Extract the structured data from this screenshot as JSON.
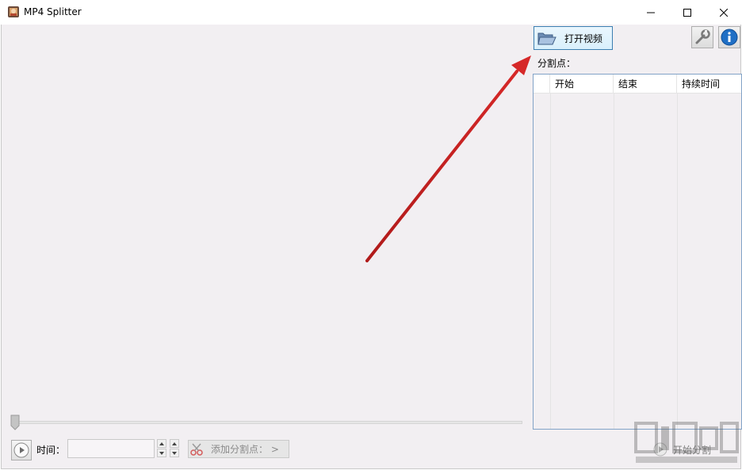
{
  "window": {
    "title": "MP4 Splitter"
  },
  "toolbar": {
    "open_video_label": "打开视频"
  },
  "split_points": {
    "label": "分割点：",
    "columns": [
      "开始",
      "结束",
      "持续时间"
    ],
    "rows": []
  },
  "playback": {
    "time_label": "时间：",
    "time_value": "",
    "progress": 0
  },
  "actions": {
    "add_split_label": "添加分割点： >",
    "start_split_label": "开始分割"
  },
  "colors": {
    "client_bg": "#f2eff2",
    "accent_border": "#3c7fb1",
    "annotation_arrow": "#c81e1e",
    "info_blue": "#1f6fc5"
  },
  "icons": {
    "app": "app-icon",
    "folder": "folder-open-icon",
    "wrench": "wrench-icon",
    "info": "info-icon",
    "play": "play-icon",
    "scissors": "scissors-icon"
  }
}
